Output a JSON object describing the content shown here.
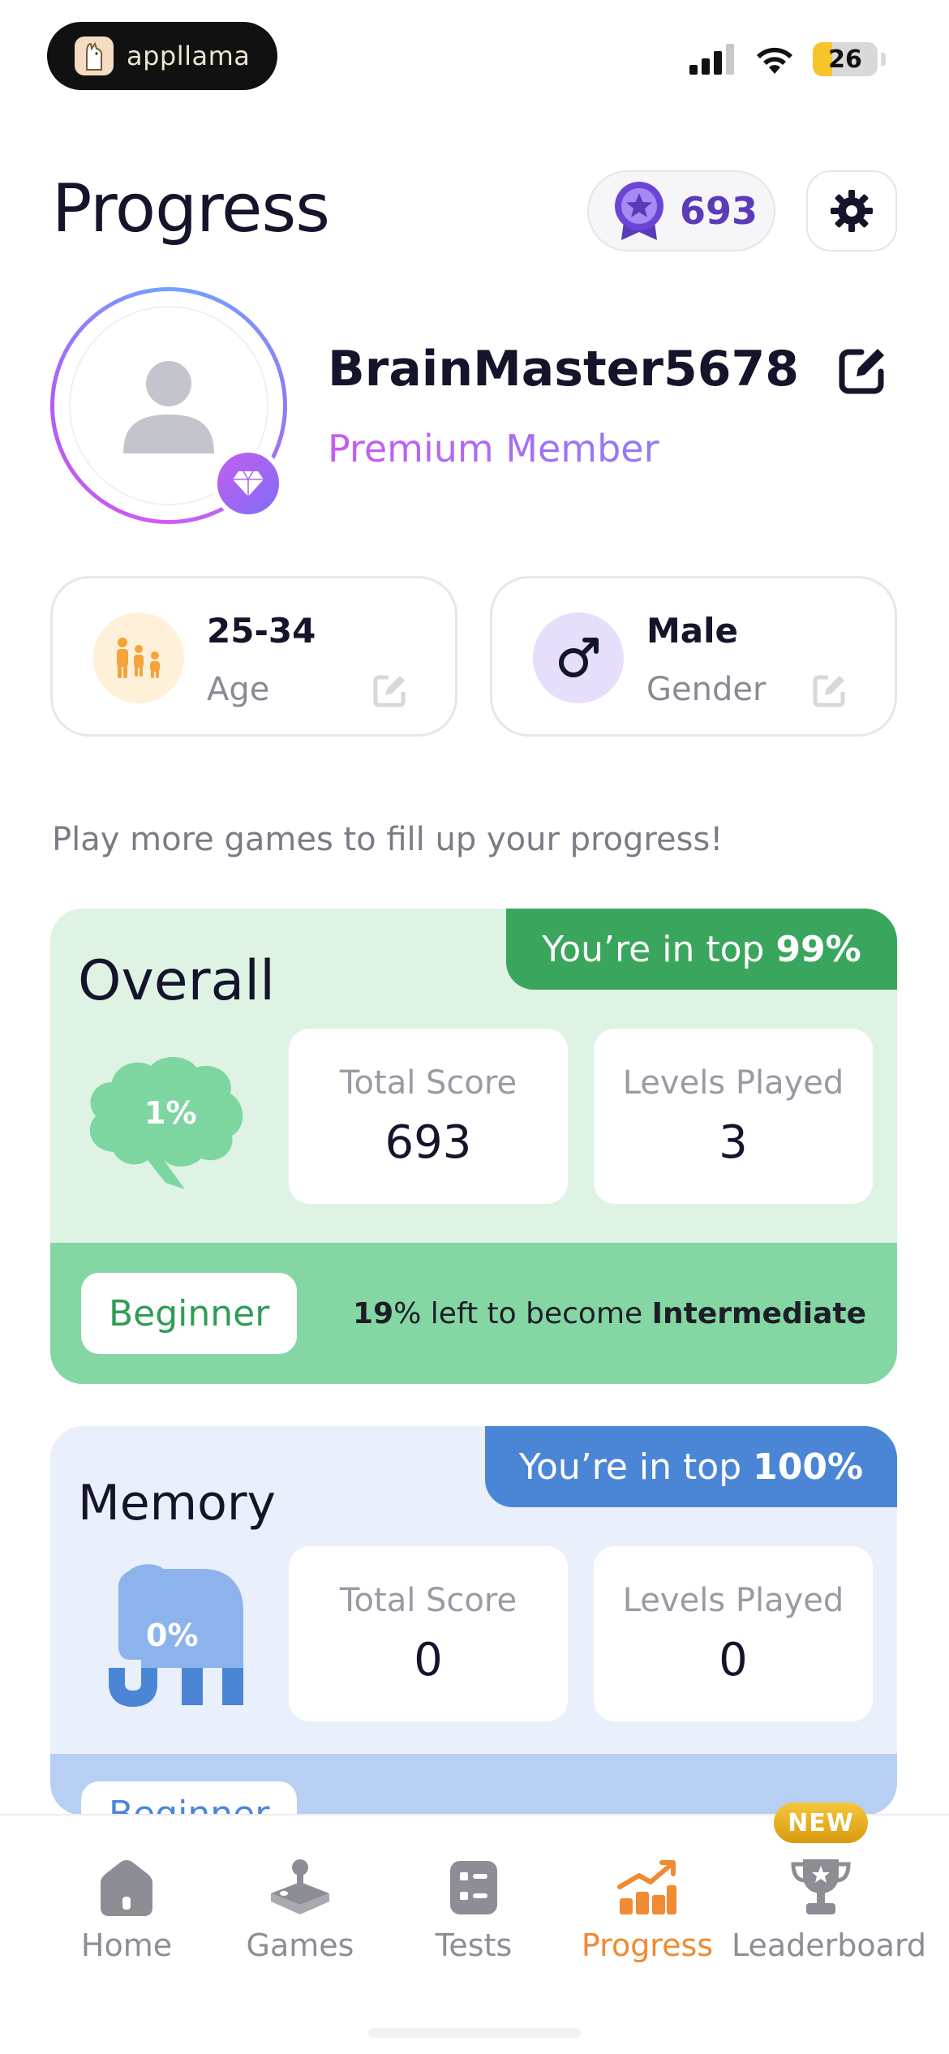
{
  "status_bar": {
    "app_name": "appllama",
    "battery": "26"
  },
  "header": {
    "title": "Progress",
    "points": "693"
  },
  "profile": {
    "username": "BrainMaster5678",
    "membership": "Premium Member"
  },
  "info": {
    "age_value": "25-34",
    "age_label": "Age",
    "gender_value": "Male",
    "gender_label": "Gender"
  },
  "hint": "Play more games to fill up your progress!",
  "overall": {
    "title": "Overall",
    "rank_prefix": "You’re in top",
    "rank_value": "99%",
    "percent": "1%",
    "total_score_label": "Total Score",
    "total_score": "693",
    "levels_played_label": "Levels Played",
    "levels_played": "3",
    "level_name": "Beginner",
    "left_pct": "19",
    "left_text": "% left to become",
    "next_level": "Intermediate"
  },
  "memory": {
    "title": "Memory",
    "rank_prefix": "You’re in top",
    "rank_value": "100%",
    "percent": "0%",
    "total_score_label": "Total Score",
    "total_score": "0",
    "levels_played_label": "Levels Played",
    "levels_played": "0",
    "level_name": "Beginner"
  },
  "tabs": [
    {
      "label": "Home",
      "icon": "home-icon",
      "active": false
    },
    {
      "label": "Games",
      "icon": "joystick-icon",
      "active": false
    },
    {
      "label": "Tests",
      "icon": "clipboard-icon",
      "active": false
    },
    {
      "label": "Progress",
      "icon": "chart-icon",
      "active": true
    },
    {
      "label": "Leaderboard",
      "icon": "trophy-icon",
      "active": false
    }
  ],
  "new_badge": "NEW",
  "colors": {
    "accent_orange": "#f08a33",
    "overall_green": "#3aa65d",
    "memory_blue": "#4b86d6",
    "points_purple": "#5b3bb8"
  }
}
